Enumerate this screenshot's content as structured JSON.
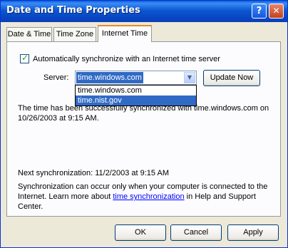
{
  "window": {
    "title": "Date and Time Properties",
    "help_glyph": "?",
    "close_glyph": "✕"
  },
  "tabs": [
    {
      "label": "Date & Time"
    },
    {
      "label": "Time Zone"
    },
    {
      "label": "Internet Time",
      "active": true
    }
  ],
  "internet_time": {
    "auto_sync_checked": true,
    "auto_sync_label": "Automatically synchronize with an Internet time server",
    "server_label": "Server:",
    "server_value": "time.windows.com",
    "server_options": [
      "time.windows.com",
      "time.nist.gov"
    ],
    "highlighted_option": "time.nist.gov",
    "update_now_label": "Update Now",
    "status_line1": "The time has been successfully synchronized with time.windows.com on",
    "status_line2": "10/26/2003 at 9:15 AM.",
    "next_sync": "Next synchronization: 11/2/2003 at 9:15 AM",
    "note_line1": "Synchronization can occur only when your computer is connected to the",
    "note_line2_prefix": "Internet.  Learn more about ",
    "note_link": "time synchronization",
    "note_line2_suffix": " in Help and Support",
    "note_line3": "Center."
  },
  "footer": {
    "ok_label": "OK",
    "cancel_label": "Cancel",
    "apply_label": "Apply"
  },
  "colors": {
    "titlebar": "#0a58d2",
    "selection": "#316ac5",
    "active_tab_accent": "#e68b2c",
    "dialog_background": "#ece9d8",
    "link": "#0000ff"
  }
}
